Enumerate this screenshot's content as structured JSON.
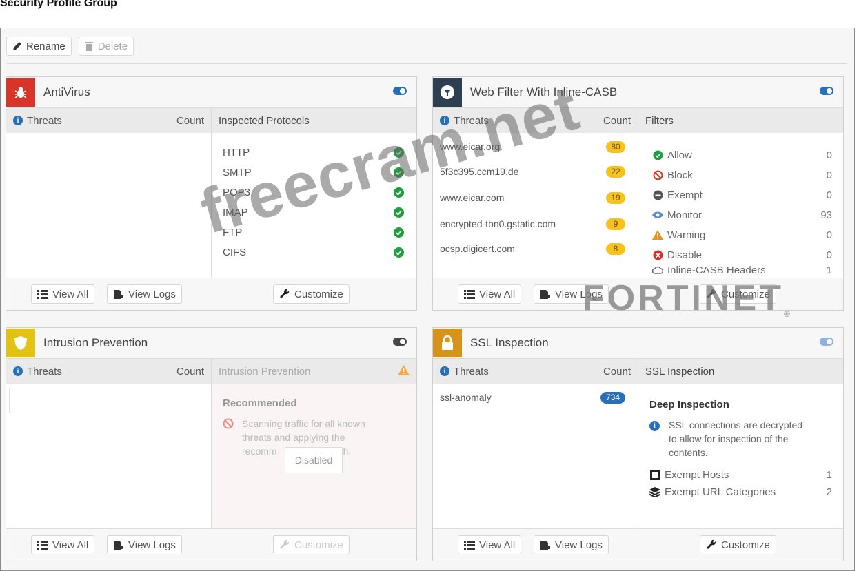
{
  "page": {
    "title": "Security Profile Group"
  },
  "toolbar": {
    "rename_label": "Rename",
    "delete_label": "Delete"
  },
  "colors": {
    "antivirus": "#d8342a",
    "webfilter": "#2e3f52",
    "ips": "#e2c314",
    "ssl": "#d7941c",
    "toggle_on": "#2a6fb5",
    "toggle_off": "#444444",
    "ok": "#1e9e3f",
    "badge": "#f6c21b",
    "badge_blue": "#2a6fb5"
  },
  "common": {
    "threats_label": "Threats",
    "count_label": "Count",
    "view_all": "View All",
    "view_logs": "View Logs",
    "customize": "Customize"
  },
  "antivirus": {
    "title": "AntiVirus",
    "icon": "bug-icon",
    "right_header": "Inspected Protocols",
    "protocols": [
      "HTTP",
      "SMTP",
      "POP3",
      "IMAP",
      "FTP",
      "CIFS"
    ]
  },
  "webfilter": {
    "title": "Web Filter With Inline-CASB",
    "icon": "filter-icon",
    "right_header": "Filters",
    "threats": [
      {
        "name": "www.eicar.org",
        "count": "80"
      },
      {
        "name": "5f3c395.ccm19.de",
        "count": "22"
      },
      {
        "name": "www.eicar.com",
        "count": "19"
      },
      {
        "name": "encrypted-tbn0.gstatic.com",
        "count": "9"
      },
      {
        "name": "ocsp.digicert.com",
        "count": "8"
      }
    ],
    "filters": [
      {
        "label": "Allow",
        "count": "0",
        "icon": "check-circle-icon"
      },
      {
        "label": "Block",
        "count": "0",
        "icon": "block-icon"
      },
      {
        "label": "Exempt",
        "count": "0",
        "icon": "minus-circle-icon"
      },
      {
        "label": "Monitor",
        "count": "93",
        "icon": "eye-icon"
      },
      {
        "label": "Warning",
        "count": "0",
        "icon": "warning-icon"
      },
      {
        "label": "Disable",
        "count": "0",
        "icon": "x-circle-icon"
      },
      {
        "label": "Inline-CASB Headers",
        "count": "1",
        "icon": "cloud-icon"
      }
    ]
  },
  "ips": {
    "title": "Intrusion Prevention",
    "icon": "shield-icon",
    "right_header": "Intrusion Prevention",
    "recommended_label": "Recommended",
    "recommended_text_1": "Scanning traffic for all known",
    "recommended_text_2": "threats and applying the",
    "recommended_text_3": "recomm",
    "recommended_text_4": "h.",
    "disabled_tooltip": "Disabled"
  },
  "ssl": {
    "title": "SSL Inspection",
    "icon": "lock-icon",
    "right_header": "SSL Inspection",
    "threats": [
      {
        "name": "ssl-anomaly",
        "count": "734"
      }
    ],
    "deep_title": "Deep Inspection",
    "deep_text_1": "SSL connections are decrypted",
    "deep_text_2": "to allow for inspection of the",
    "deep_text_3": "contents.",
    "exempt_hosts_label": "Exempt Hosts",
    "exempt_hosts_count": "1",
    "exempt_url_label": "Exempt URL Categories",
    "exempt_url_count": "2"
  },
  "overlay": {
    "watermark": "freecram.net",
    "brand": "FORTINET",
    "reg": "®"
  }
}
